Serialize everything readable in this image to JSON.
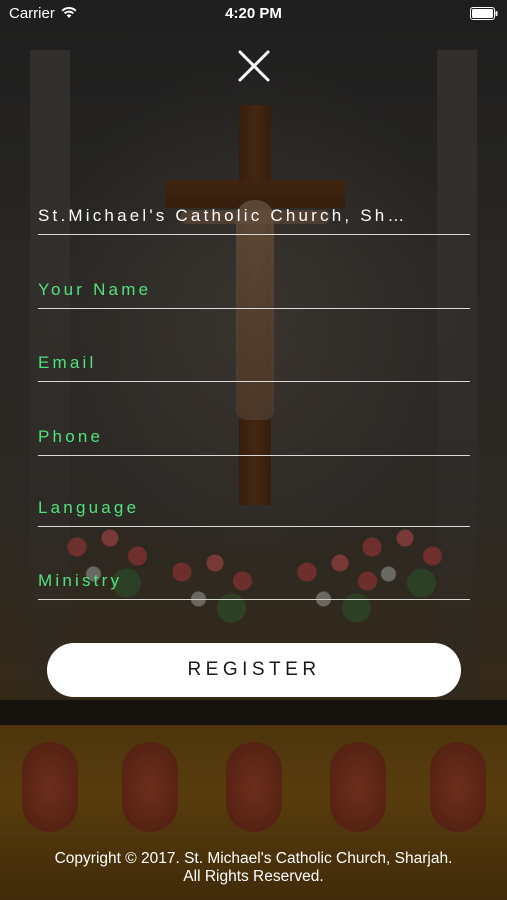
{
  "status_bar": {
    "carrier": "Carrier",
    "time": "4:20 PM",
    "wifi_icon": "wifi-icon",
    "battery_icon": "battery-icon"
  },
  "close_icon": "close-icon",
  "form": {
    "church": {
      "value": "St.Michael's Catholic Church, Sh…"
    },
    "name": {
      "placeholder": "Your Name"
    },
    "email": {
      "placeholder": "Email"
    },
    "phone": {
      "placeholder": "Phone"
    },
    "language": {
      "placeholder": "Language"
    },
    "ministry": {
      "placeholder": "Ministry"
    }
  },
  "register_label": "REGISTER",
  "footer": {
    "line1": "Copyright © 2017. St. Michael's Catholic Church, Sharjah.",
    "line2": "All Rights Reserved."
  },
  "colors": {
    "placeholder": "#4fe27c",
    "field_underline": "#d9d9d9",
    "button_bg": "#ffffff",
    "button_text": "#1a1a1a"
  }
}
